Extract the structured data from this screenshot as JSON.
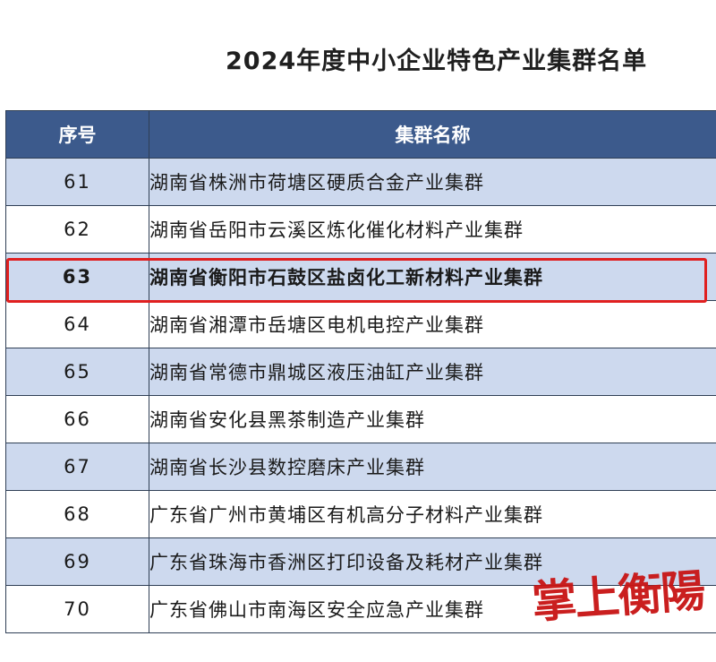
{
  "title": "2024年度中小企业特色产业集群名单",
  "table": {
    "headers": [
      "序号",
      "集群名称"
    ],
    "rows": [
      {
        "num": "61",
        "name": "湖南省株洲市荷塘区硬质合金产业集群"
      },
      {
        "num": "62",
        "name": "湖南省岳阳市云溪区炼化催化材料产业集群"
      },
      {
        "num": "63",
        "name": "湖南省衡阳市石鼓区盐卤化工新材料产业集群"
      },
      {
        "num": "64",
        "name": "湖南省湘潭市岳塘区电机电控产业集群"
      },
      {
        "num": "65",
        "name": "湖南省常德市鼎城区液压油缸产业集群"
      },
      {
        "num": "66",
        "name": "湖南省安化县黑茶制造产业集群"
      },
      {
        "num": "67",
        "name": "湖南省长沙县数控磨床产业集群"
      },
      {
        "num": "68",
        "name": "广东省广州市黄埔区有机高分子材料产业集群"
      },
      {
        "num": "69",
        "name": "广东省珠海市香洲区打印设备及耗材产业集群"
      },
      {
        "num": "70",
        "name": "广东省佛山市南海区安全应急产业集群"
      }
    ],
    "highlighted_row": "63"
  },
  "watermark": "掌上衡陽",
  "colors": {
    "header_bg": "#3c5a8c",
    "odd_row_bg": "#cdd9ee",
    "highlight_border": "#e02020",
    "watermark": "#c81414"
  }
}
